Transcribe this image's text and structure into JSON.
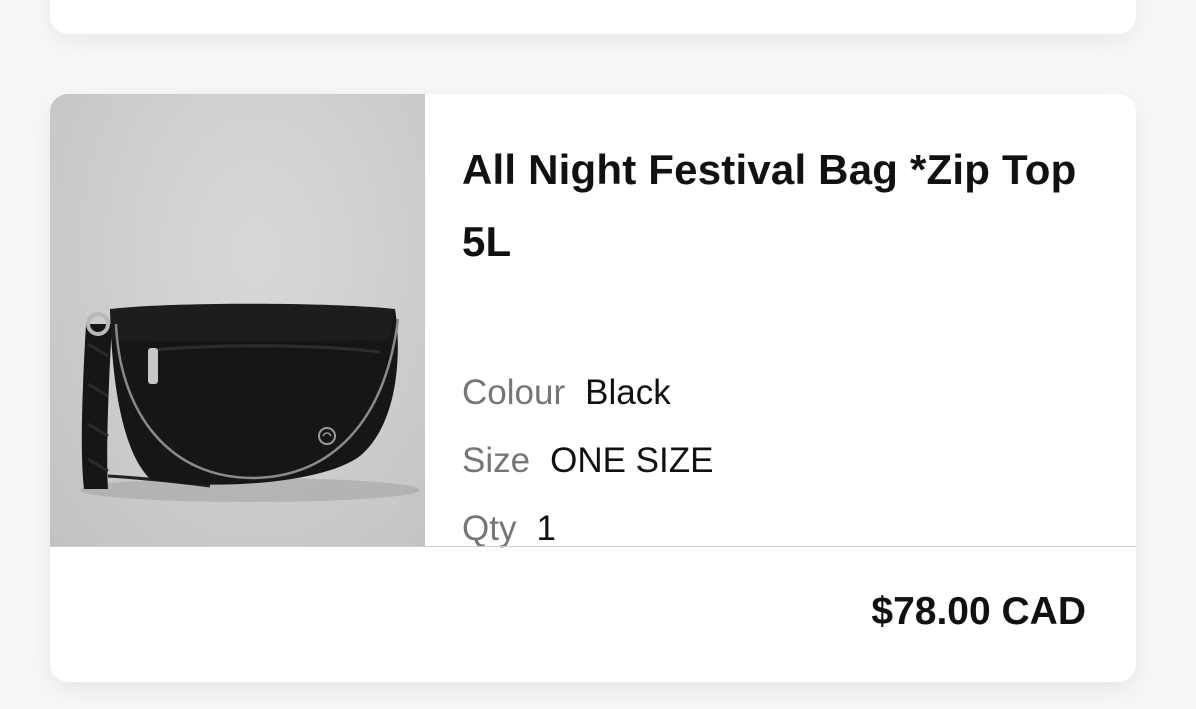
{
  "product": {
    "title": "All Night Festival Bag *Zip Top 5L",
    "image_alt": "Black crossbody festival bag with zip top",
    "attributes": [
      {
        "label": "Colour",
        "value": "Black"
      },
      {
        "label": "Size",
        "value": "ONE SIZE"
      },
      {
        "label": "Qty",
        "value": "1"
      }
    ],
    "price": "$78.00 CAD"
  }
}
